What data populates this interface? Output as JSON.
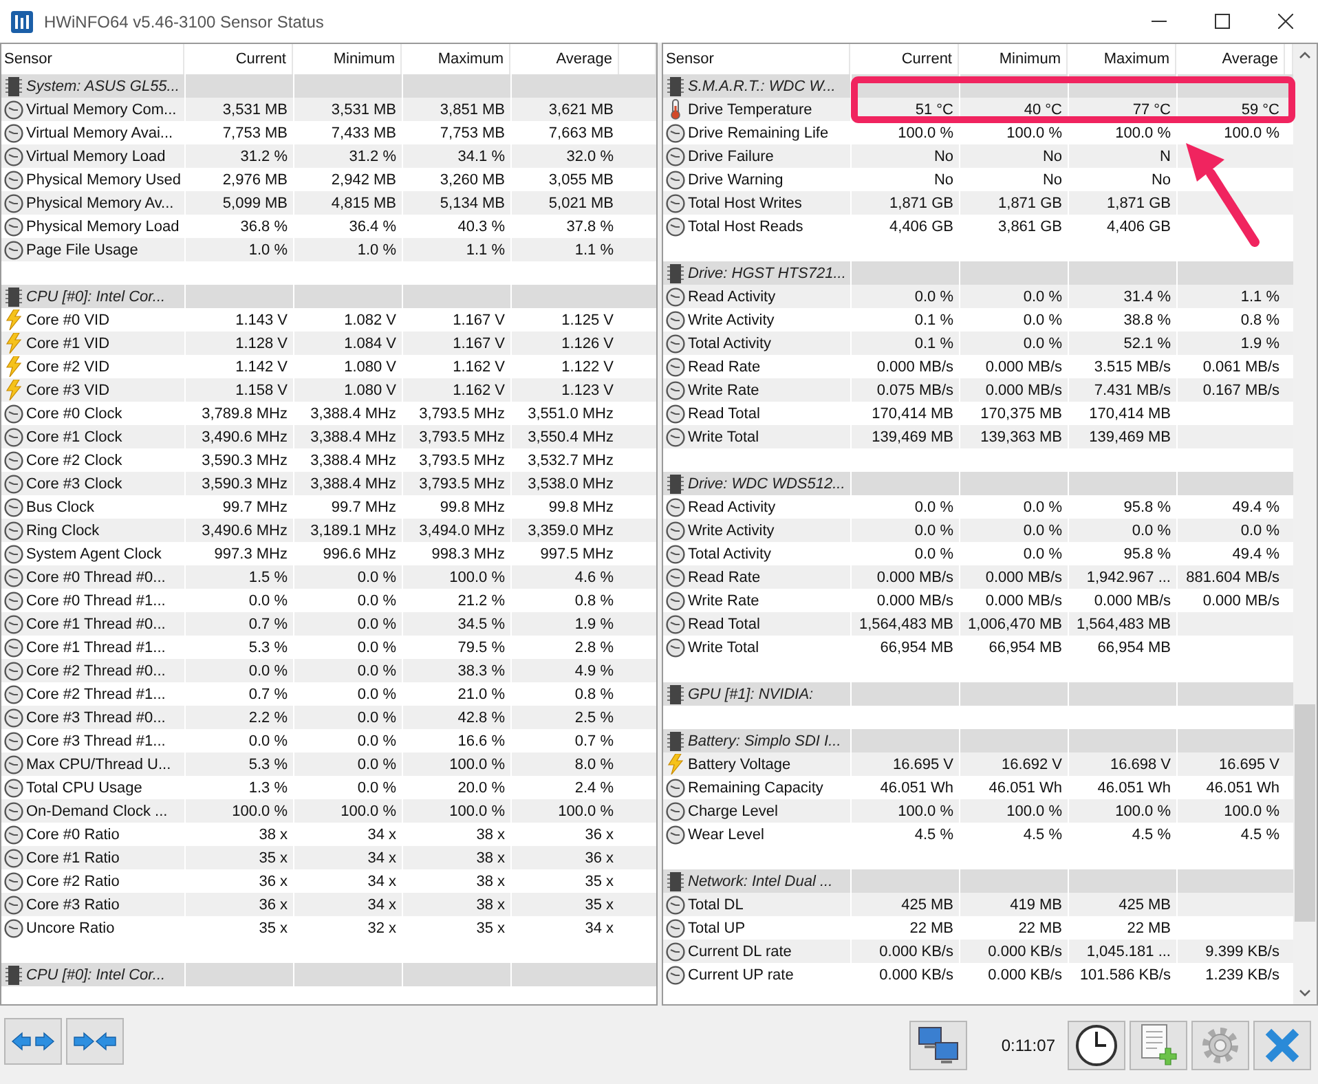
{
  "window": {
    "title": "HWiNFO64 v5.46-3100 Sensor Status"
  },
  "panels": [
    {
      "columns": [
        "Sensor",
        "Current",
        "Minimum",
        "Maximum",
        "Average"
      ],
      "rows": [
        {
          "kind": "group",
          "label": "System: ASUS GL55..."
        },
        {
          "kind": "gauge",
          "name": "Virtual Memory Com...",
          "values": [
            "3,531 MB",
            "3,531 MB",
            "3,851 MB",
            "3,621 MB"
          ]
        },
        {
          "kind": "gauge",
          "name": "Virtual Memory Avai...",
          "values": [
            "7,753 MB",
            "7,433 MB",
            "7,753 MB",
            "7,663 MB"
          ]
        },
        {
          "kind": "gauge",
          "name": "Virtual Memory Load",
          "values": [
            "31.2 %",
            "31.2 %",
            "34.1 %",
            "32.0 %"
          ]
        },
        {
          "kind": "gauge",
          "name": "Physical Memory Used",
          "values": [
            "2,976 MB",
            "2,942 MB",
            "3,260 MB",
            "3,055 MB"
          ]
        },
        {
          "kind": "gauge",
          "name": "Physical Memory Av...",
          "values": [
            "5,099 MB",
            "4,815 MB",
            "5,134 MB",
            "5,021 MB"
          ]
        },
        {
          "kind": "gauge",
          "name": "Physical Memory Load",
          "values": [
            "36.8 %",
            "36.4 %",
            "40.3 %",
            "37.8 %"
          ]
        },
        {
          "kind": "gauge",
          "name": "Page File Usage",
          "values": [
            "1.0 %",
            "1.0 %",
            "1.1 %",
            "1.1 %"
          ]
        },
        {
          "kind": "blank"
        },
        {
          "kind": "group",
          "label": "CPU [#0]: Intel Cor..."
        },
        {
          "kind": "voltage",
          "name": "Core #0 VID",
          "values": [
            "1.143 V",
            "1.082 V",
            "1.167 V",
            "1.125 V"
          ]
        },
        {
          "kind": "voltage",
          "name": "Core #1 VID",
          "values": [
            "1.128 V",
            "1.084 V",
            "1.167 V",
            "1.126 V"
          ]
        },
        {
          "kind": "voltage",
          "name": "Core #2 VID",
          "values": [
            "1.142 V",
            "1.080 V",
            "1.162 V",
            "1.122 V"
          ]
        },
        {
          "kind": "voltage",
          "name": "Core #3 VID",
          "values": [
            "1.158 V",
            "1.080 V",
            "1.162 V",
            "1.123 V"
          ]
        },
        {
          "kind": "gauge",
          "name": "Core #0 Clock",
          "values": [
            "3,789.8 MHz",
            "3,388.4 MHz",
            "3,793.5 MHz",
            "3,551.0 MHz"
          ]
        },
        {
          "kind": "gauge",
          "name": "Core #1 Clock",
          "values": [
            "3,490.6 MHz",
            "3,388.4 MHz",
            "3,793.5 MHz",
            "3,550.4 MHz"
          ]
        },
        {
          "kind": "gauge",
          "name": "Core #2 Clock",
          "values": [
            "3,590.3 MHz",
            "3,388.4 MHz",
            "3,793.5 MHz",
            "3,532.7 MHz"
          ]
        },
        {
          "kind": "gauge",
          "name": "Core #3 Clock",
          "values": [
            "3,590.3 MHz",
            "3,388.4 MHz",
            "3,793.5 MHz",
            "3,538.0 MHz"
          ]
        },
        {
          "kind": "gauge",
          "name": "Bus Clock",
          "values": [
            "99.7 MHz",
            "99.7 MHz",
            "99.8 MHz",
            "99.8 MHz"
          ]
        },
        {
          "kind": "gauge",
          "name": "Ring Clock",
          "values": [
            "3,490.6 MHz",
            "3,189.1 MHz",
            "3,494.0 MHz",
            "3,359.0 MHz"
          ]
        },
        {
          "kind": "gauge",
          "name": "System Agent Clock",
          "values": [
            "997.3 MHz",
            "996.6 MHz",
            "998.3 MHz",
            "997.5 MHz"
          ]
        },
        {
          "kind": "gauge",
          "name": "Core #0 Thread #0...",
          "values": [
            "1.5 %",
            "0.0 %",
            "100.0 %",
            "4.6 %"
          ]
        },
        {
          "kind": "gauge",
          "name": "Core #0 Thread #1...",
          "values": [
            "0.0 %",
            "0.0 %",
            "21.2 %",
            "0.8 %"
          ]
        },
        {
          "kind": "gauge",
          "name": "Core #1 Thread #0...",
          "values": [
            "0.7 %",
            "0.0 %",
            "34.5 %",
            "1.9 %"
          ]
        },
        {
          "kind": "gauge",
          "name": "Core #1 Thread #1...",
          "values": [
            "5.3 %",
            "0.0 %",
            "79.5 %",
            "2.8 %"
          ]
        },
        {
          "kind": "gauge",
          "name": "Core #2 Thread #0...",
          "values": [
            "0.0 %",
            "0.0 %",
            "38.3 %",
            "4.9 %"
          ]
        },
        {
          "kind": "gauge",
          "name": "Core #2 Thread #1...",
          "values": [
            "0.7 %",
            "0.0 %",
            "21.0 %",
            "0.8 %"
          ]
        },
        {
          "kind": "gauge",
          "name": "Core #3 Thread #0...",
          "values": [
            "2.2 %",
            "0.0 %",
            "42.8 %",
            "2.5 %"
          ]
        },
        {
          "kind": "gauge",
          "name": "Core #3 Thread #1...",
          "values": [
            "0.0 %",
            "0.0 %",
            "16.6 %",
            "0.7 %"
          ]
        },
        {
          "kind": "gauge",
          "name": "Max CPU/Thread U...",
          "values": [
            "5.3 %",
            "0.0 %",
            "100.0 %",
            "8.0 %"
          ]
        },
        {
          "kind": "gauge",
          "name": "Total CPU Usage",
          "values": [
            "1.3 %",
            "0.0 %",
            "20.0 %",
            "2.4 %"
          ]
        },
        {
          "kind": "gauge",
          "name": "On-Demand Clock ...",
          "values": [
            "100.0 %",
            "100.0 %",
            "100.0 %",
            "100.0 %"
          ]
        },
        {
          "kind": "gauge",
          "name": "Core #0 Ratio",
          "values": [
            "38 x",
            "34 x",
            "38 x",
            "36 x"
          ]
        },
        {
          "kind": "gauge",
          "name": "Core #1 Ratio",
          "values": [
            "35 x",
            "34 x",
            "38 x",
            "36 x"
          ]
        },
        {
          "kind": "gauge",
          "name": "Core #2 Ratio",
          "values": [
            "36 x",
            "34 x",
            "38 x",
            "35 x"
          ]
        },
        {
          "kind": "gauge",
          "name": "Core #3 Ratio",
          "values": [
            "36 x",
            "34 x",
            "38 x",
            "35 x"
          ]
        },
        {
          "kind": "gauge",
          "name": "Uncore Ratio",
          "values": [
            "35 x",
            "32 x",
            "35 x",
            "34 x"
          ]
        },
        {
          "kind": "blank"
        },
        {
          "kind": "group",
          "label": "CPU [#0]: Intel Cor..."
        },
        {
          "kind": "blank"
        }
      ]
    },
    {
      "columns": [
        "Sensor",
        "Current",
        "Minimum",
        "Maximum",
        "Average"
      ],
      "rows": [
        {
          "kind": "group",
          "label": "S.M.A.R.T.: WDC W..."
        },
        {
          "kind": "temperature",
          "name": "Drive Temperature",
          "values": [
            "51 °C",
            "40 °C",
            "77 °C",
            "59 °C"
          ]
        },
        {
          "kind": "gauge",
          "name": "Drive Remaining Life",
          "values": [
            "100.0 %",
            "100.0 %",
            "100.0 %",
            "100.0 %"
          ]
        },
        {
          "kind": "gauge",
          "name": "Drive Failure",
          "values": [
            "No",
            "No",
            "N"
          ]
        },
        {
          "kind": "gauge",
          "name": "Drive Warning",
          "values": [
            "No",
            "No",
            "No"
          ]
        },
        {
          "kind": "gauge",
          "name": "Total Host Writes",
          "values": [
            "1,871 GB",
            "1,871 GB",
            "1,871 GB"
          ]
        },
        {
          "kind": "gauge",
          "name": "Total Host Reads",
          "values": [
            "4,406 GB",
            "3,861 GB",
            "4,406 GB"
          ]
        },
        {
          "kind": "blank"
        },
        {
          "kind": "group",
          "label": "Drive: HGST HTS721..."
        },
        {
          "kind": "gauge",
          "name": "Read Activity",
          "values": [
            "0.0 %",
            "0.0 %",
            "31.4 %",
            "1.1 %"
          ]
        },
        {
          "kind": "gauge",
          "name": "Write Activity",
          "values": [
            "0.1 %",
            "0.0 %",
            "38.8 %",
            "0.8 %"
          ]
        },
        {
          "kind": "gauge",
          "name": "Total Activity",
          "values": [
            "0.1 %",
            "0.0 %",
            "52.1 %",
            "1.9 %"
          ]
        },
        {
          "kind": "gauge",
          "name": "Read Rate",
          "values": [
            "0.000 MB/s",
            "0.000 MB/s",
            "3.515 MB/s",
            "0.061 MB/s"
          ]
        },
        {
          "kind": "gauge",
          "name": "Write Rate",
          "values": [
            "0.075 MB/s",
            "0.000 MB/s",
            "7.431 MB/s",
            "0.167 MB/s"
          ]
        },
        {
          "kind": "gauge",
          "name": "Read Total",
          "values": [
            "170,414 MB",
            "170,375 MB",
            "170,414 MB"
          ]
        },
        {
          "kind": "gauge",
          "name": "Write Total",
          "values": [
            "139,469 MB",
            "139,363 MB",
            "139,469 MB"
          ]
        },
        {
          "kind": "blank"
        },
        {
          "kind": "group",
          "label": "Drive: WDC WDS512..."
        },
        {
          "kind": "gauge",
          "name": "Read Activity",
          "values": [
            "0.0 %",
            "0.0 %",
            "95.8 %",
            "49.4 %"
          ]
        },
        {
          "kind": "gauge",
          "name": "Write Activity",
          "values": [
            "0.0 %",
            "0.0 %",
            "0.0 %",
            "0.0 %"
          ]
        },
        {
          "kind": "gauge",
          "name": "Total Activity",
          "values": [
            "0.0 %",
            "0.0 %",
            "95.8 %",
            "49.4 %"
          ]
        },
        {
          "kind": "gauge",
          "name": "Read Rate",
          "values": [
            "0.000 MB/s",
            "0.000 MB/s",
            "1,942.967 ...",
            "881.604 MB/s"
          ]
        },
        {
          "kind": "gauge",
          "name": "Write Rate",
          "values": [
            "0.000 MB/s",
            "0.000 MB/s",
            "0.000 MB/s",
            "0.000 MB/s"
          ]
        },
        {
          "kind": "gauge",
          "name": "Read Total",
          "values": [
            "1,564,483 MB",
            "1,006,470 MB",
            "1,564,483 MB"
          ]
        },
        {
          "kind": "gauge",
          "name": "Write Total",
          "values": [
            "66,954 MB",
            "66,954 MB",
            "66,954 MB"
          ]
        },
        {
          "kind": "blank"
        },
        {
          "kind": "group",
          "label": "GPU [#1]: NVIDIA:"
        },
        {
          "kind": "blank"
        },
        {
          "kind": "group",
          "label": "Battery: Simplo SDI I..."
        },
        {
          "kind": "voltage",
          "name": "Battery Voltage",
          "values": [
            "16.695 V",
            "16.692 V",
            "16.698 V",
            "16.695 V"
          ]
        },
        {
          "kind": "gauge",
          "name": "Remaining Capacity",
          "values": [
            "46.051 Wh",
            "46.051 Wh",
            "46.051 Wh",
            "46.051 Wh"
          ]
        },
        {
          "kind": "gauge",
          "name": "Charge Level",
          "values": [
            "100.0 %",
            "100.0 %",
            "100.0 %",
            "100.0 %"
          ]
        },
        {
          "kind": "gauge",
          "name": "Wear Level",
          "values": [
            "4.5 %",
            "4.5 %",
            "4.5 %",
            "4.5 %"
          ]
        },
        {
          "kind": "blank"
        },
        {
          "kind": "group",
          "label": "Network: Intel Dual ..."
        },
        {
          "kind": "gauge",
          "name": "Total DL",
          "values": [
            "425 MB",
            "419 MB",
            "425 MB"
          ]
        },
        {
          "kind": "gauge",
          "name": "Total UP",
          "values": [
            "22 MB",
            "22 MB",
            "22 MB"
          ]
        },
        {
          "kind": "gauge",
          "name": "Current DL rate",
          "values": [
            "0.000 KB/s",
            "0.000 KB/s",
            "1,045.181 ...",
            "9.399 KB/s"
          ]
        },
        {
          "kind": "gauge",
          "name": "Current UP rate",
          "values": [
            "0.000 KB/s",
            "0.000 KB/s",
            "101.586 KB/s",
            "1.239 KB/s"
          ]
        },
        {
          "kind": "blank"
        }
      ]
    }
  ],
  "toolbar": {
    "elapsed_time": "0:11:07"
  }
}
